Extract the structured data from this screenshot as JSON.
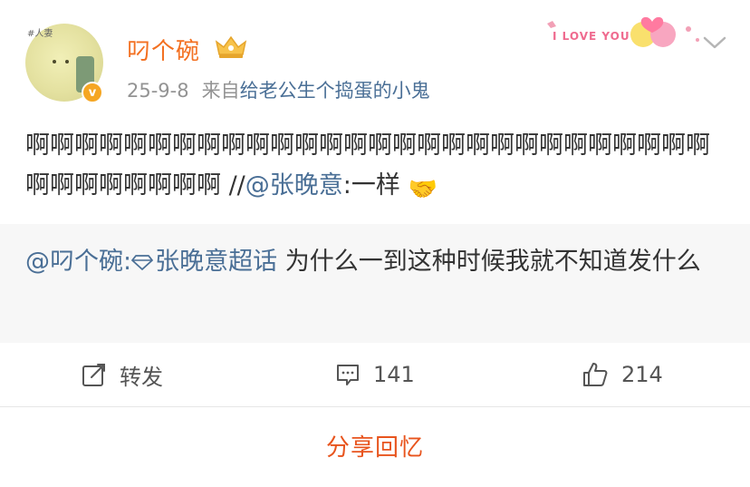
{
  "post": {
    "username": "叼个碗",
    "date": "25-9-8",
    "source_prefix": "来自",
    "source_name": "给老公生个捣蛋的小鬼",
    "avatar_tag": "#人妻",
    "verified_mark": "v",
    "decoration_text": "I LOVE YOU",
    "content": {
      "text_main": "啊啊啊啊啊啊啊啊啊啊啊啊啊啊啊啊啊啊啊啊啊啊啊啊啊啊啊啊啊啊啊啊啊啊啊啊 //",
      "mention": "@张晚意",
      "after_mention": ":一样",
      "emoji": "🤝"
    },
    "quote": {
      "mention": "@叼个碗:",
      "topic": "张晚意超话",
      "text": " 为什么一到这种时候我就不知道发什么"
    },
    "actions": {
      "repost_label": "转发",
      "comment_count": "141",
      "like_count": "214"
    },
    "share_memory_label": "分享回忆"
  },
  "colors": {
    "username": "#f37021",
    "link": "#4a6f96",
    "share": "#e8541d",
    "quote_bg": "#f7f7f7"
  }
}
